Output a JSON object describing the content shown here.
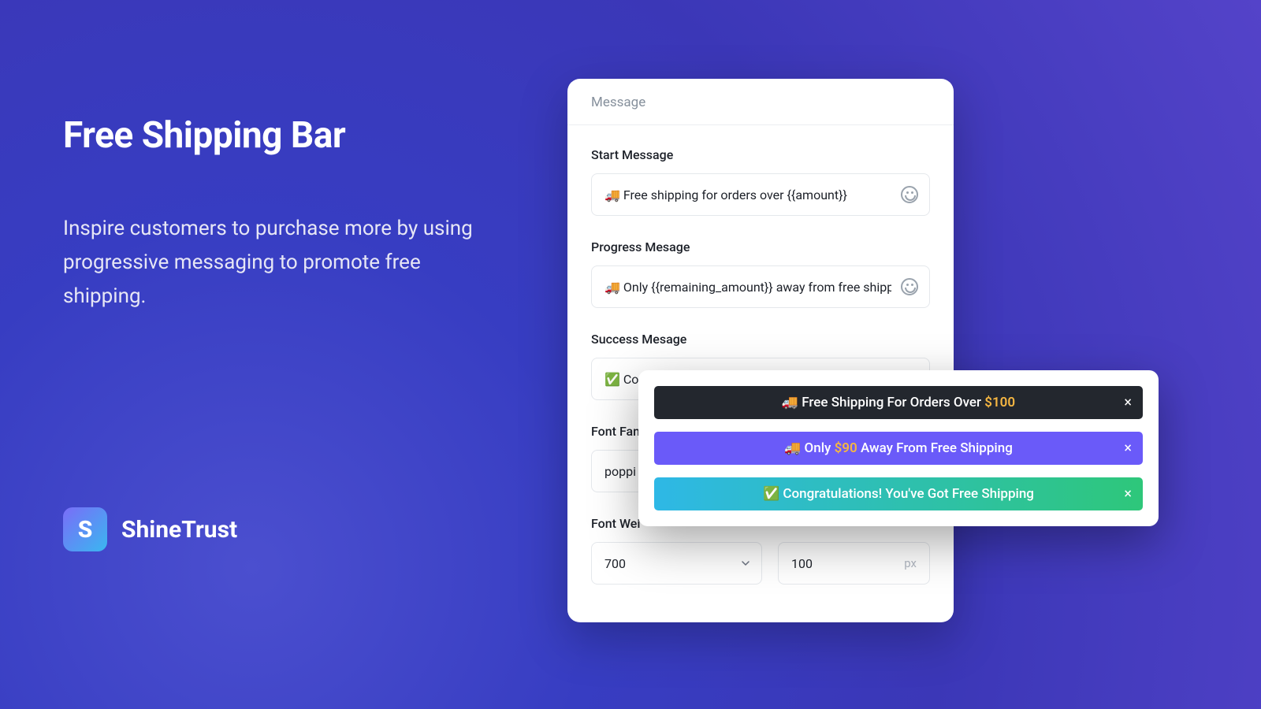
{
  "hero": {
    "title": "Free Shipping Bar",
    "subtitle": "Inspire customers to purchase more by using progressive messaging to promote free shipping."
  },
  "brand": {
    "name": "ShineTrust",
    "logo_letter": "S"
  },
  "panel": {
    "header": "Message",
    "start_label": "Start Message",
    "start_value": "🚚 Free shipping for orders over {{amount}}",
    "progress_label": "Progress Mesage",
    "progress_value": "🚚 Only {{remaining_amount}} away from free shipping",
    "success_label": "Success Mesage",
    "success_value": "✅ Con",
    "font_family_label": "Font Fam",
    "font_family_value": "poppi",
    "font_weight_label": "Font Wei",
    "font_weight_value": "700",
    "font_size_value": "100",
    "font_size_unit": "px"
  },
  "preview": {
    "bar1_prefix": "🚚 Free Shipping For Orders Over ",
    "bar1_amount": "$100",
    "bar2_prefix": "🚚 Only ",
    "bar2_amount": "$90",
    "bar2_suffix": " Away From Free Shipping",
    "bar3_text": "✅ Congratulations! You've Got Free Shipping",
    "close": "×"
  }
}
